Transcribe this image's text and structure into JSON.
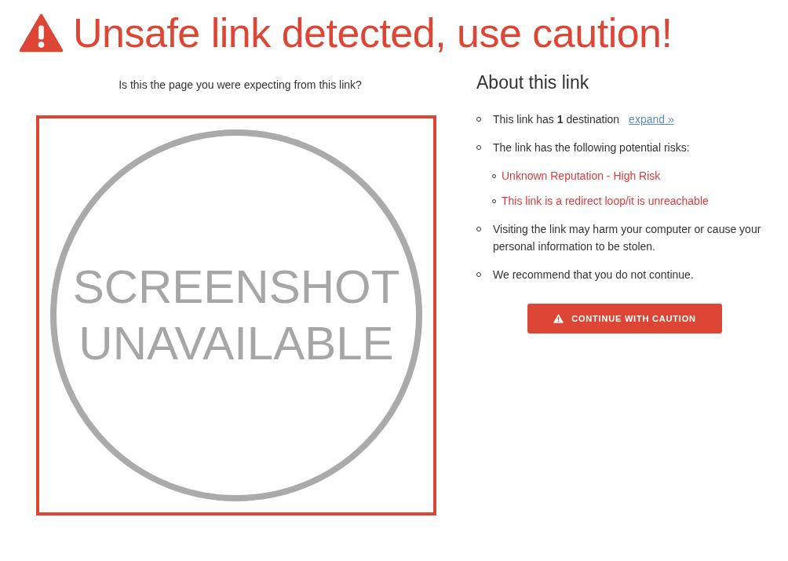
{
  "title": "Unsafe link detected, use caution!",
  "preview": {
    "question": "Is this the page you were expecting from this link?",
    "placeholder_lines": [
      "SCREENSHOT",
      "UNAVAILABLE"
    ]
  },
  "about": {
    "heading": "About this link",
    "items": [
      {
        "text": "This link has **1** destination",
        "link": "expand »"
      },
      {
        "text": "The link has the following potential risks:",
        "children": [
          {
            "text": "Unknown Reputation - High Risk"
          },
          {
            "text": "This link is a redirect loop/it is unreachable"
          }
        ]
      },
      {
        "text": "Visiting the link may harm your computer or cause your personal information to be stolen."
      },
      {
        "text": "We recommend that you do not continue."
      }
    ]
  },
  "button": {
    "label": "CONTINUE WITH CAUTION"
  }
}
